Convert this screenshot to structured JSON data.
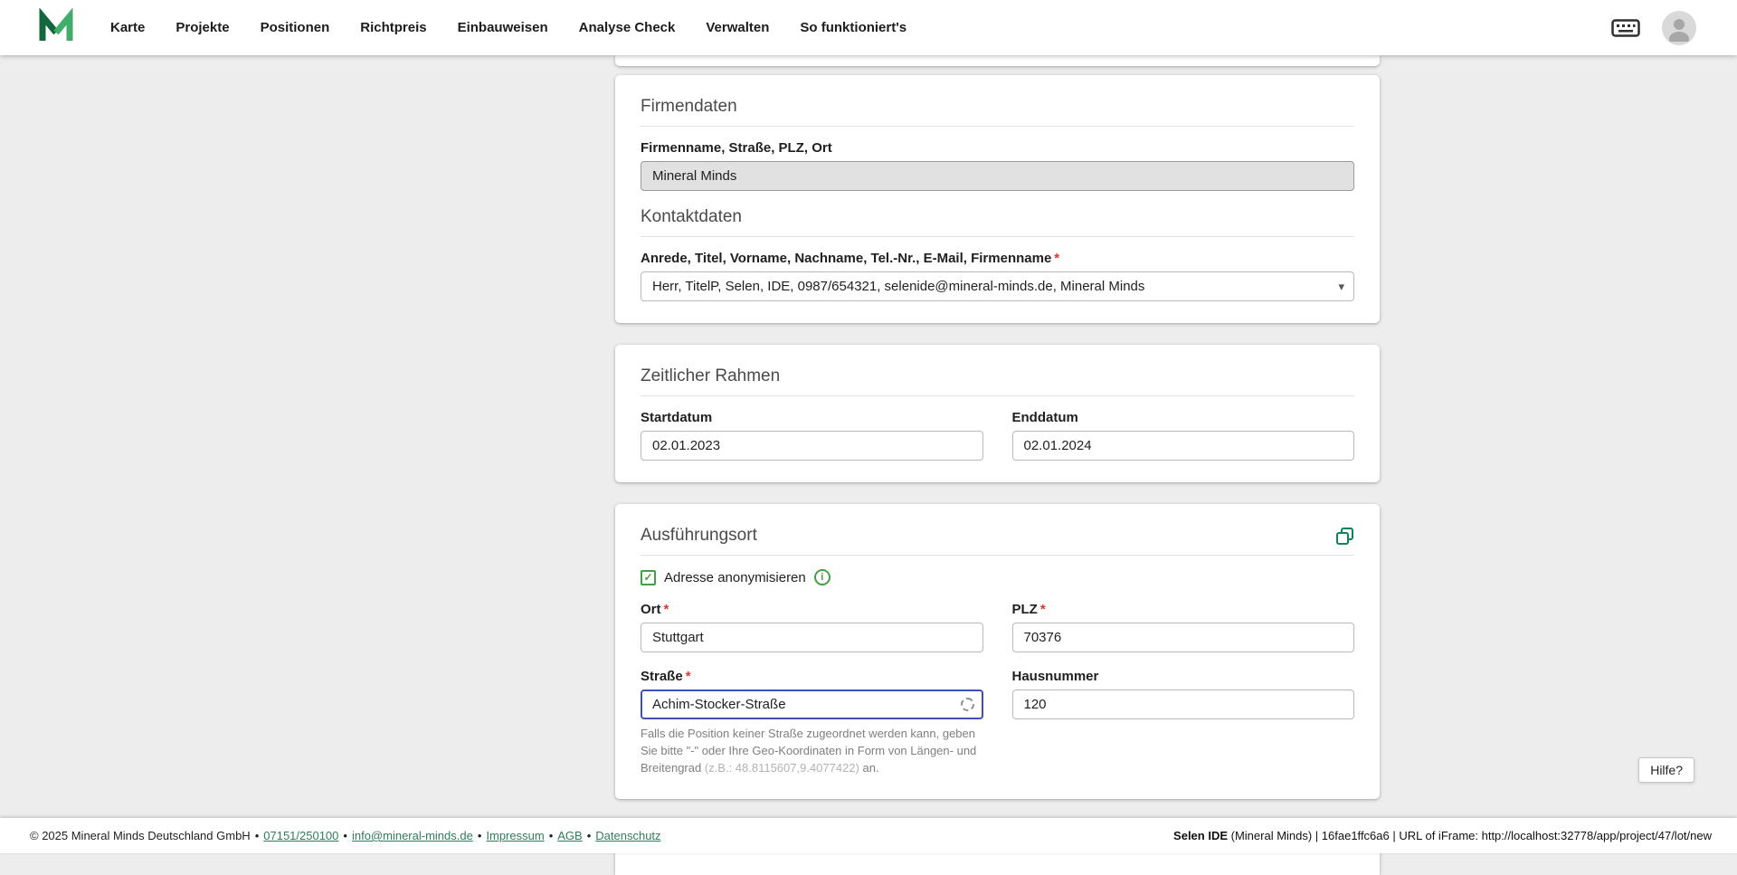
{
  "colors": {
    "accent_green": "#43a047",
    "focus_border": "#3f51b5",
    "required_red": "#e0352b",
    "link_green": "#2f7d5b"
  },
  "icons": {
    "check": "✓",
    "info": "i",
    "caret": "▾",
    "separator": "•"
  },
  "nav": {
    "items": [
      "Karte",
      "Projekte",
      "Positionen",
      "Richtpreis",
      "Einbauweisen",
      "Analyse Check",
      "Verwalten",
      "So funktioniert's"
    ]
  },
  "required_marker": "*",
  "firmendaten": {
    "title": "Firmendaten",
    "company_label": "Firmenname, Straße, PLZ, Ort",
    "company_value": "Mineral Minds",
    "kontakt_title": "Kontaktdaten",
    "contact_label": "Anrede, Titel, Vorname, Nachname, Tel.-Nr., E-Mail, Firmenname",
    "contact_value": "Herr, TitelP, Selen, IDE, 0987/654321, selenide@mineral-minds.de, Mineral Minds"
  },
  "zeitraum": {
    "title": "Zeitlicher Rahmen",
    "start_label": "Startdatum",
    "start_value": "02.01.2023",
    "end_label": "Enddatum",
    "end_value": "02.01.2024"
  },
  "ausfuehrungsort": {
    "title": "Ausführungsort",
    "anonymize_label": "Adresse anonymisieren",
    "ort_label": "Ort",
    "ort_value": "Stuttgart",
    "plz_label": "PLZ",
    "plz_value": "70376",
    "strasse_label": "Straße",
    "strasse_value": "Achim-Stocker-Straße",
    "hausnummer_label": "Hausnummer",
    "hausnummer_value": "120",
    "hint_text": "Falls die Position keiner Straße zugeordnet werden kann, geben Sie bitte \"-\" oder Ihre Geo-Koordinaten in Form von Längen- und Breitengrad ",
    "hint_coords": "(z.B.: 48.8115607,9.4077422)",
    "hint_suffix": " an."
  },
  "help": {
    "label": "Hilfe?"
  },
  "footer": {
    "copyright": "© 2025 Mineral Minds Deutschland GmbH",
    "links": [
      "07151/250100",
      "info@mineral-minds.de",
      "Impressum",
      "AGB",
      "Datenschutz"
    ],
    "right_bold": "Selen IDE",
    "right_rest": " (Mineral Minds) | 16fae1ffc6a6 | URL of iFrame: http://localhost:32778/app/project/47/lot/new"
  }
}
